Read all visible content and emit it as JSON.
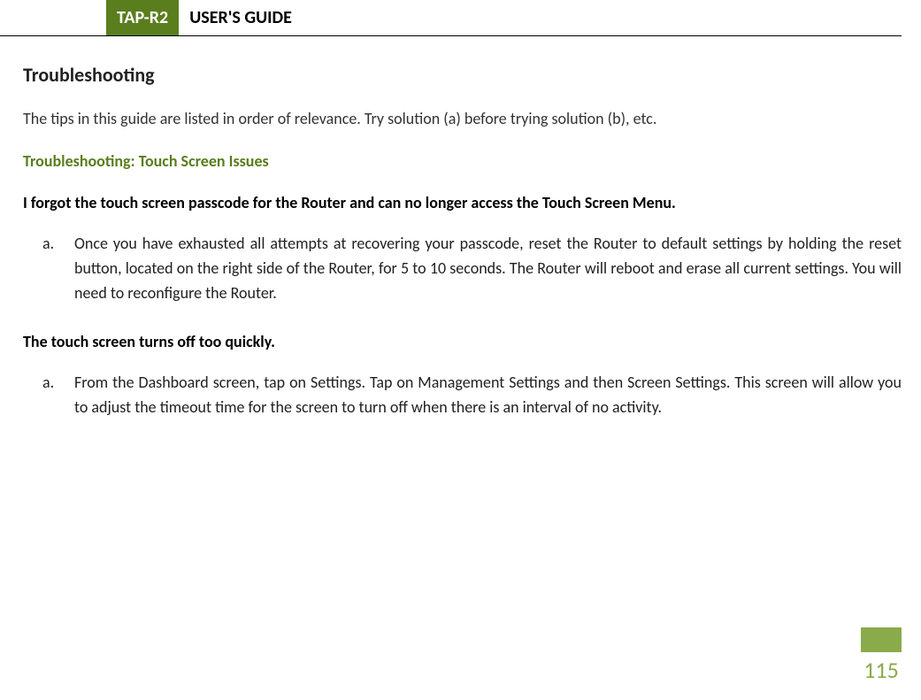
{
  "header": {
    "product": "TAP-R2",
    "title": "USER'S GUIDE"
  },
  "sections": {
    "heading": "Troubleshooting",
    "intro": "The tips in this guide are listed in order of relevance. Try solution (a) before trying solution (b), etc.",
    "subheading": "Troubleshooting: Touch Screen Issues",
    "topics": [
      {
        "question": "I forgot the touch screen passcode for the Router and can no longer access the Touch Screen Menu.",
        "items": [
          {
            "marker": "a.",
            "text": "Once you have exhausted all attempts at recovering your passcode, reset the Router to default settings by holding the reset button, located on the right side of the Router, for 5 to 10 seconds.  The Router will reboot and erase all current settings.  You will need to reconfigure the Router."
          }
        ]
      },
      {
        "question": "The touch screen turns off too quickly.",
        "items": [
          {
            "marker": "a.",
            "text": "From the Dashboard screen, tap on Settings.  Tap on Management Settings and then Screen Settings.  This screen will allow you to adjust the timeout time for the screen to turn off when there is an interval of no activity."
          }
        ]
      }
    ]
  },
  "page_number": "115"
}
